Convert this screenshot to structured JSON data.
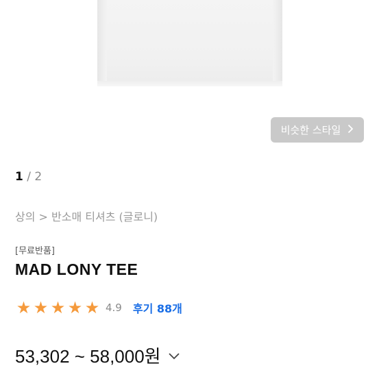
{
  "gallery": {
    "similar_style_label": "비슷한 스타일",
    "similar_style_icon": "chevron-right-icon",
    "pager_current": "1",
    "pager_separator": "/",
    "pager_total": "2"
  },
  "breadcrumb": "상의 > 반소매 티셔츠 (글로니)",
  "product": {
    "badge": "[무료반품]",
    "title": "MAD LONY TEE",
    "rating": "4.9",
    "stars": 5,
    "review_label": "후기 88개",
    "price_range": "53,302 ~ 58,000원",
    "price_toggle_icon": "chevron-down-icon"
  },
  "colors": {
    "star": "#f59a3c",
    "link": "#1a6ee6",
    "button_bg": "#c9c9c9"
  }
}
